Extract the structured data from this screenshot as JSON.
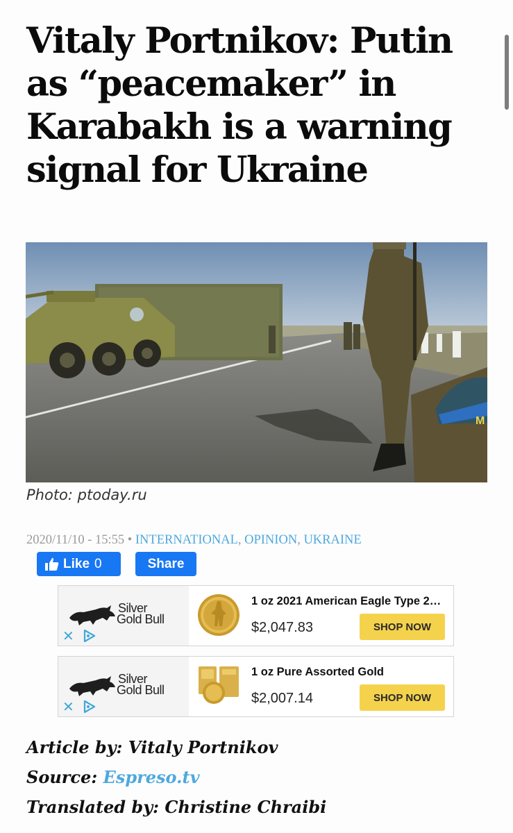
{
  "article": {
    "headline": "Vitaly Portnikov: Putin as “peacemaker” in Karabakh is a warning signal for Ukraine",
    "photo_caption": "Photo: ptoday.ru",
    "meta": {
      "date": "2020/11/10 - 15:55",
      "separator": " • ",
      "categories": [
        "INTERNATIONAL",
        "OPINION",
        "UKRAINE"
      ],
      "comma": ", "
    }
  },
  "social": {
    "like_label": "Like",
    "like_count": "0",
    "share_label": "Share"
  },
  "ads": [
    {
      "brand_line1": "Silver",
      "brand_line2": "Gold Bull",
      "title": "1 oz 2021 American Eagle Type 2…",
      "price": "$2,047.83",
      "cta": "SHOP NOW",
      "close_glyph": "✕",
      "product_icon": "gold-coin-icon"
    },
    {
      "brand_line1": "Silver",
      "brand_line2": "Gold Bull",
      "title": "1 oz Pure Assorted Gold",
      "price": "$2,007.14",
      "cta": "SHOP NOW",
      "close_glyph": "✕",
      "product_icon": "gold-bars-icon"
    }
  ],
  "credits": {
    "author_label": "Article by:",
    "author": "Vitaly Portnikov",
    "source_label": "Source:",
    "source": "Espreso.tv",
    "translator_label": "Translated by:",
    "translator": "Christine Chraibi"
  },
  "colors": {
    "link": "#4ea8de",
    "facebook": "#1877f2",
    "cta": "#f5d24c",
    "meta": "#9a9a9a"
  }
}
